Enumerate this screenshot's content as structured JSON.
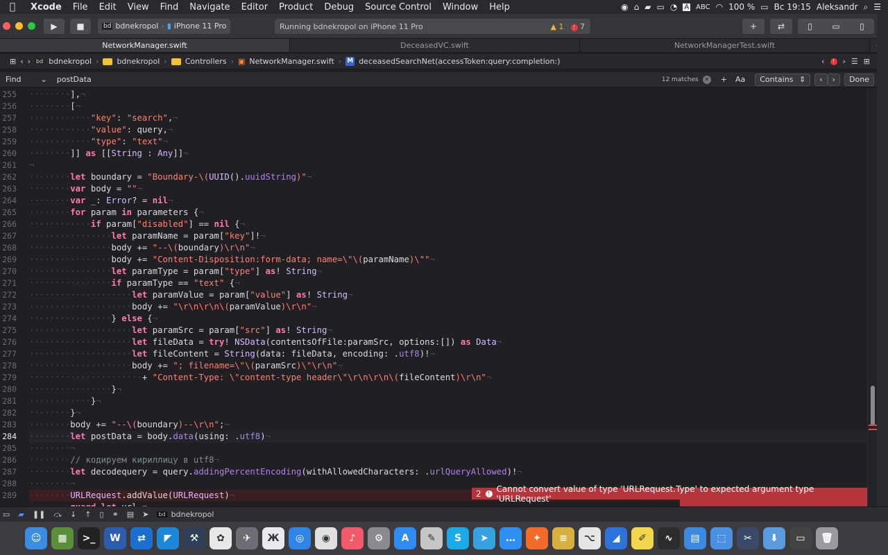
{
  "menubar": {
    "app": "Xcode",
    "items": [
      "File",
      "Edit",
      "View",
      "Find",
      "Navigate",
      "Editor",
      "Product",
      "Debug",
      "Source Control",
      "Window",
      "Help"
    ],
    "right": {
      "input": "ABC",
      "battery": "100 %",
      "clock": "Вс 19:15",
      "user": "Aleksandr"
    }
  },
  "toolbar": {
    "scheme": "bdnekropol",
    "device": "iPhone 11 Pro",
    "status": "Running bdnekropol on iPhone 11 Pro",
    "warnings": "1",
    "errors": "7"
  },
  "tabs": [
    "NetworkManager.swift",
    "DeceasedVC.swift",
    "NetworkManagerTest.swift"
  ],
  "jumpbar": {
    "project": "bdnekropol",
    "group": "bdnekropol",
    "folder": "Controllers",
    "file": "NetworkManager.swift",
    "method": "deceasedSearchNet(accessToken:query:completion:)"
  },
  "find": {
    "mode": "Find",
    "query": "postData",
    "matches": "12 matches",
    "aa": "Aa",
    "contains": "Contains",
    "done": "Done"
  },
  "lines": [
    {
      "n": "255",
      "ind": 8,
      "html": "],"
    },
    {
      "n": "256",
      "ind": 8,
      "html": "["
    },
    {
      "n": "257",
      "ind": 12,
      "html": "<span class='s'>\"key\"</span>: <span class='s'>\"search\"</span>,"
    },
    {
      "n": "258",
      "ind": 12,
      "html": "<span class='s'>\"value\"</span>: query,"
    },
    {
      "n": "259",
      "ind": 12,
      "html": "<span class='s'>\"type\"</span>: <span class='s'>\"text\"</span>"
    },
    {
      "n": "260",
      "ind": 8,
      "html": "]] <span class='k'>as</span> [[<span class='t'>String</span> : <span class='t'>Any</span>]]"
    },
    {
      "n": "261",
      "ind": 0,
      "html": ""
    },
    {
      "n": "262",
      "ind": 8,
      "html": "<span class='k'>let</span> boundary = <span class='s'>\"Boundary-\\(</span><span class='t'>UUID</span>().<span class='p'>uuidString</span><span class='s'>)\"</span>"
    },
    {
      "n": "263",
      "ind": 8,
      "html": "<span class='k'>var</span> body = <span class='s'>\"\"</span>"
    },
    {
      "n": "264",
      "ind": 8,
      "html": "<span class='k'>var</span> _: <span class='t'>Error</span>? = <span class='k'>nil</span>"
    },
    {
      "n": "265",
      "ind": 8,
      "html": "<span class='k'>for</span> param <span class='k'>in</span> parameters {"
    },
    {
      "n": "266",
      "ind": 12,
      "html": "<span class='k'>if</span> param[<span class='s'>\"disabled\"</span>] == <span class='k'>nil</span> {"
    },
    {
      "n": "267",
      "ind": 16,
      "html": "<span class='k'>let</span> paramName = param[<span class='s'>\"key\"</span>]!"
    },
    {
      "n": "268",
      "ind": 16,
      "html": "body += <span class='s'>\"--\\(</span>boundary<span class='s'>)\\r\\n\"</span>"
    },
    {
      "n": "269",
      "ind": 16,
      "html": "body += <span class='s'>\"Content-Disposition:form-data; name=\\\"\\(</span>paramName<span class='s'>)\\\"\"</span>"
    },
    {
      "n": "270",
      "ind": 16,
      "html": "<span class='k'>let</span> paramType = param[<span class='s'>\"type\"</span>] <span class='k'>as</span>! <span class='t'>String</span>"
    },
    {
      "n": "271",
      "ind": 16,
      "html": "<span class='k'>if</span> paramType == <span class='s'>\"text\"</span> {"
    },
    {
      "n": "272",
      "ind": 20,
      "html": "<span class='k'>let</span> paramValue = param[<span class='s'>\"value\"</span>] <span class='k'>as</span>! <span class='t'>String</span>"
    },
    {
      "n": "273",
      "ind": 20,
      "html": "body += <span class='s'>\"\\r\\n\\r\\n\\(</span>paramValue<span class='s'>)\\r\\n\"</span>"
    },
    {
      "n": "274",
      "ind": 16,
      "html": "} <span class='k'>else</span> {"
    },
    {
      "n": "275",
      "ind": 20,
      "html": "<span class='k'>let</span> paramSrc = param[<span class='s'>\"src\"</span>] <span class='k'>as</span>! <span class='t'>String</span>"
    },
    {
      "n": "276",
      "ind": 20,
      "html": "<span class='k'>let</span> fileData = <span class='k'>try</span>! <span class='t'>NSData</span>(contentsOfFile:paramSrc, options:[]) <span class='k'>as</span> <span class='t'>Data</span>"
    },
    {
      "n": "277",
      "ind": 20,
      "html": "<span class='k'>let</span> fileContent = <span class='t'>String</span>(data: fileData, encoding: .<span class='p'>utf8</span>)!"
    },
    {
      "n": "278",
      "ind": 20,
      "html": "body += <span class='s'>\"; filename=\\\"\\(</span>paramSrc<span class='s'>)\\\"\\r\\n\"</span>"
    },
    {
      "n": "279",
      "ind": 22,
      "html": "+ <span class='s'>\"Content-Type: \\\"content-type header\\\"\\r\\n\\r\\n\\(</span>fileContent<span class='s'>)\\r\\n\"</span>"
    },
    {
      "n": "280",
      "ind": 16,
      "html": "}"
    },
    {
      "n": "281",
      "ind": 12,
      "html": "}"
    },
    {
      "n": "282",
      "ind": 8,
      "html": "}"
    },
    {
      "n": "283",
      "ind": 8,
      "html": "body += <span class='s'>\"--\\(</span>boundary<span class='s'>)--\\r\\n\"</span>;"
    },
    {
      "n": "284",
      "ind": 8,
      "html": "<span class='k'>let</span> postData = body.<span class='p'>data</span>(using: .<span class='p'>utf8</span>)",
      "cur": true
    },
    {
      "n": "285",
      "ind": 8,
      "html": ""
    },
    {
      "n": "286",
      "ind": 8,
      "html": "<span class='c'>// кодируем кириллицу в utf8</span>"
    },
    {
      "n": "287",
      "ind": 8,
      "html": "<span class='k'>let</span> decodequery = query.<span class='p'>addingPercentEncoding</span>(withAllowedCharacters: .<span class='p'>urlQueryAllowed</span>)!"
    },
    {
      "n": "288",
      "ind": 8,
      "html": ""
    },
    {
      "n": "289",
      "ind": 8,
      "html": "<span class='t'>URLRequest</span>.addValue(<span class='t'>URLRequest</span>)",
      "err": true
    },
    {
      "n": "",
      "ind": 8,
      "html": "<span class='k'>guard</span> <span class='k'>let</span> url ="
    }
  ],
  "error": {
    "count": "2",
    "message": "Cannot convert value of type 'URLRequest.Type' to expected argument type 'URLRequest'"
  },
  "debugbar": {
    "target": "bdnekropol"
  },
  "dock": [
    {
      "name": "finder",
      "color": "#3a8de0",
      "glyph": "☺"
    },
    {
      "name": "monitor",
      "color": "#5a8f3a",
      "glyph": "▦"
    },
    {
      "name": "terminal",
      "color": "#222",
      "glyph": ">_"
    },
    {
      "name": "word",
      "color": "#2b5cad",
      "glyph": "W"
    },
    {
      "name": "teamviewer",
      "color": "#1b6fd0",
      "glyph": "⇄"
    },
    {
      "name": "vscode",
      "color": "#1e88d8",
      "glyph": "◤"
    },
    {
      "name": "xcode-tools",
      "color": "#2f3f57",
      "glyph": "⚒"
    },
    {
      "name": "photos",
      "color": "#e8e8e8",
      "glyph": "✿"
    },
    {
      "name": "launchpad",
      "color": "#6d6d75",
      "glyph": "✈"
    },
    {
      "name": "instruments",
      "color": "#e9e9ee",
      "glyph": "Ж"
    },
    {
      "name": "safari",
      "color": "#2f85e6",
      "glyph": "◎"
    },
    {
      "name": "chrome",
      "color": "#e0e0e0",
      "glyph": "◉"
    },
    {
      "name": "music",
      "color": "#f05a6b",
      "glyph": "♪"
    },
    {
      "name": "preferences",
      "color": "#8a8a8f",
      "glyph": "⚙"
    },
    {
      "name": "appstore",
      "color": "#2f8bf0",
      "glyph": "A"
    },
    {
      "name": "preview",
      "color": "#c6c6c9",
      "glyph": "✎"
    },
    {
      "name": "skype",
      "color": "#1ba9e8",
      "glyph": "S"
    },
    {
      "name": "telegram",
      "color": "#36a3e0",
      "glyph": "➤"
    },
    {
      "name": "messages",
      "color": "#2f8ff0",
      "glyph": "…"
    },
    {
      "name": "swift",
      "color": "#f26b2a",
      "glyph": "✦"
    },
    {
      "name": "sequel",
      "color": "#d8b040",
      "glyph": "≡"
    },
    {
      "name": "sourcetree",
      "color": "#e6e6e6",
      "glyph": "⌥"
    },
    {
      "name": "simulator",
      "color": "#2d72d9",
      "glyph": "◢"
    },
    {
      "name": "notes",
      "color": "#f2d64b",
      "glyph": "✐"
    },
    {
      "name": "activity",
      "color": "#2c2c2c",
      "glyph": "∿"
    },
    {
      "name": "files",
      "color": "#3d88e0",
      "glyph": "▤"
    },
    {
      "name": "screenshot",
      "color": "#4a90e2",
      "glyph": "⬚"
    },
    {
      "name": "scissors",
      "color": "#3a4a66",
      "glyph": "✂"
    },
    {
      "name": "downloads",
      "color": "#5a9be0",
      "glyph": "⬇"
    },
    {
      "name": "folder",
      "color": "#444",
      "glyph": "▭"
    },
    {
      "name": "trash",
      "color": "#9a9aa0",
      "glyph": "🗑"
    }
  ]
}
